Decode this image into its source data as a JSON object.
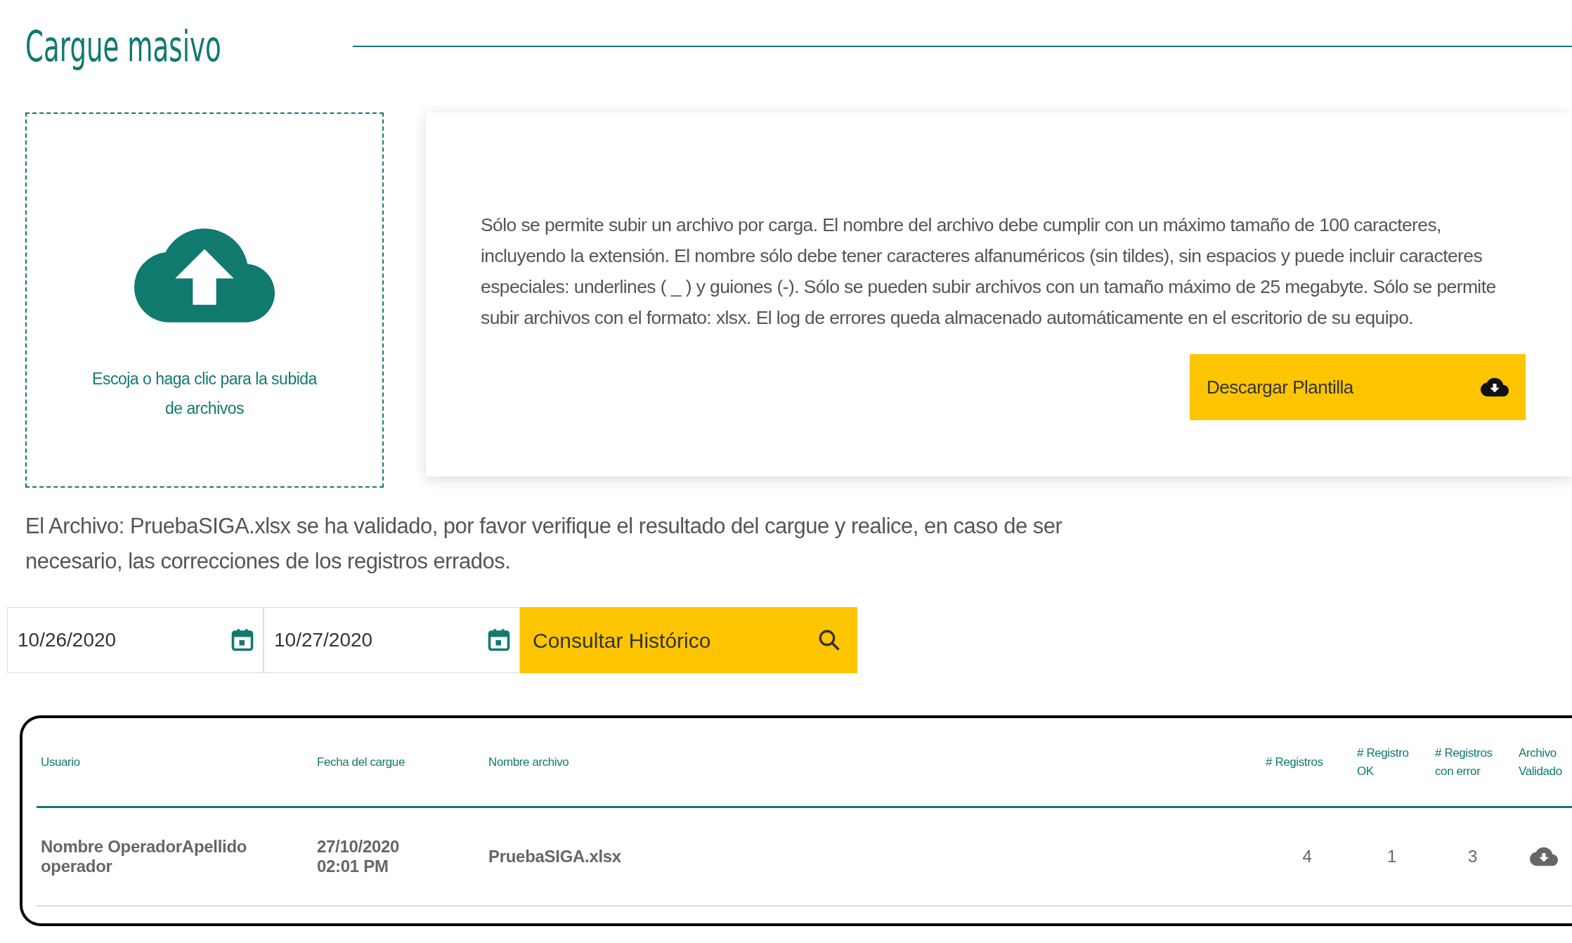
{
  "title": "Cargue masivo",
  "upload": {
    "label": "Escoja o haga clic para la subida de archivos"
  },
  "info": {
    "text": "Sólo se permite subir un archivo por carga. El nombre del archivo debe cumplir con un máximo tamaño de 100 caracteres, incluyendo la extensión. El nombre sólo debe tener caracteres alfanuméricos (sin tildes), sin espacios y puede incluir caracteres especiales: underlines ( _ ) y guiones (-). Sólo se pueden subir archivos con un tamaño máximo de 25 megabyte. Sólo se permite subir archivos con el formato: xlsx. El log de errores queda almacenado automáticamente en el escritorio de su equipo.",
    "button": "Descargar Plantilla"
  },
  "message": "El Archivo: PruebaSIGA.xlsx se ha validado, por favor verifique el resultado del cargue y realice, en caso de ser necesario, las correcciones de los registros errados.",
  "filter": {
    "date_from": "10/26/2020",
    "date_to": "10/27/2020",
    "button": "Consultar Histórico"
  },
  "table": {
    "columns": [
      "Usuario",
      "Fecha del cargue",
      "Nombre archivo",
      "# Registros",
      "# Registro OK",
      "# Registros con error",
      "Archivo Validado"
    ],
    "rows": [
      {
        "cells": [
          "Nombre OperadorApellido operador",
          "27/10/2020 02:01 PM",
          "PruebaSIGA.xlsx",
          "4",
          "1",
          "3"
        ]
      }
    ]
  }
}
